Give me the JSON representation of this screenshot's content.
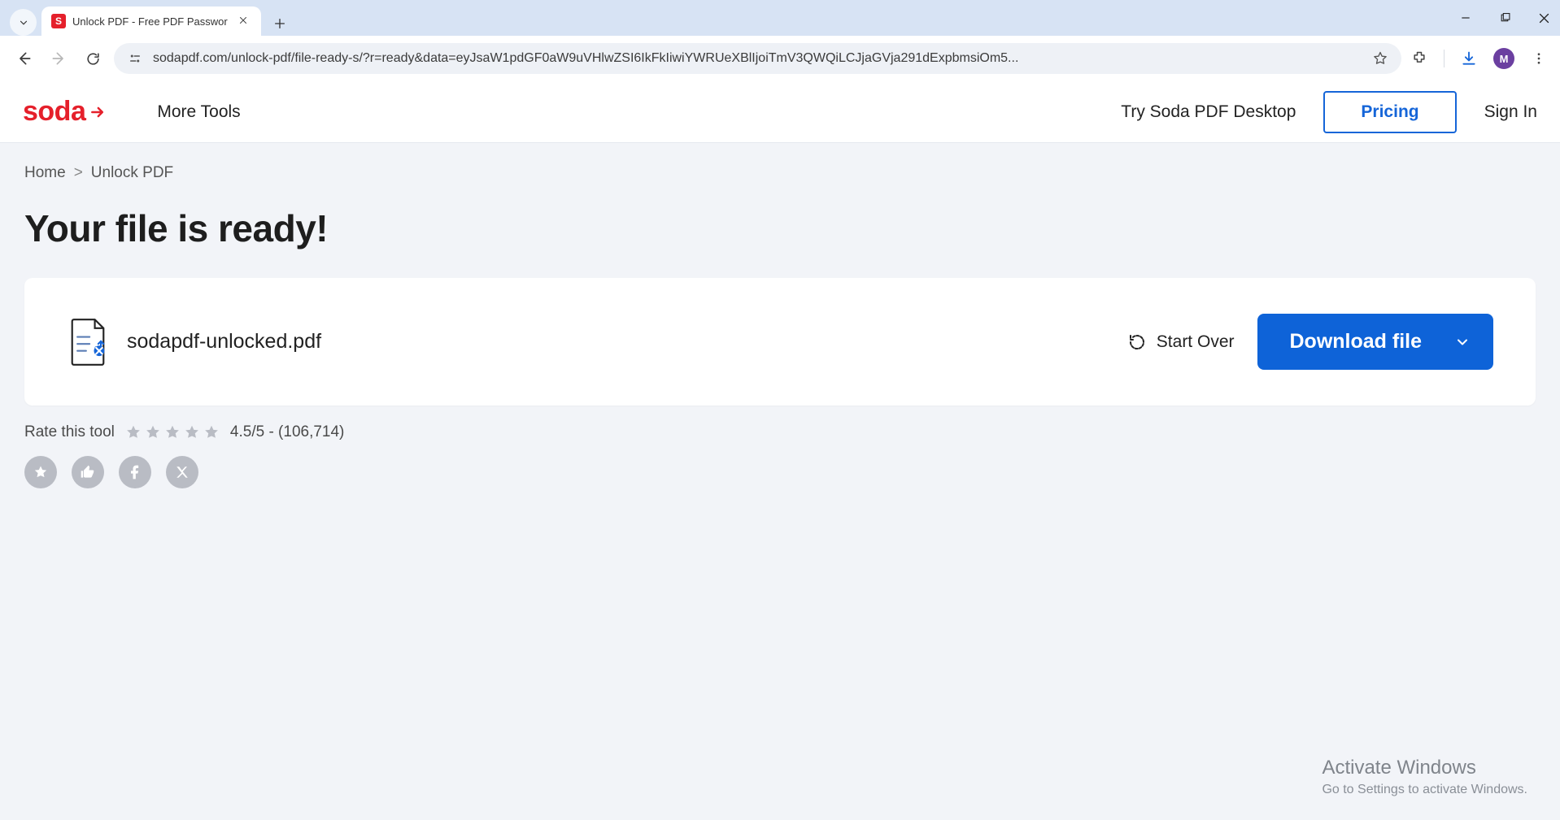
{
  "browser": {
    "tab_title": "Unlock PDF - Free PDF Passwor",
    "favicon_letter": "S",
    "url": "sodapdf.com/unlock-pdf/file-ready-s/?r=ready&data=eyJsaW1pdGF0aW9uVHlwZSI6IkFkIiwiYWRUeXBlIjoiTmV3QWQiLCJjaGVja291dExpbmsiOm5...",
    "avatar_letter": "M"
  },
  "header": {
    "logo_text": "soda",
    "more_tools": "More Tools",
    "try_desktop": "Try Soda PDF Desktop",
    "pricing": "Pricing",
    "sign_in": "Sign In"
  },
  "breadcrumb": {
    "home": "Home",
    "current": "Unlock PDF"
  },
  "main": {
    "headline": "Your file is ready!",
    "file_name": "sodapdf-unlocked.pdf",
    "start_over": "Start Over",
    "download": "Download file"
  },
  "rating": {
    "label": "Rate this tool",
    "score_text": "4.5/5 - (106,714)"
  },
  "watermark": {
    "line1": "Activate Windows",
    "line2": "Go to Settings to activate Windows."
  }
}
